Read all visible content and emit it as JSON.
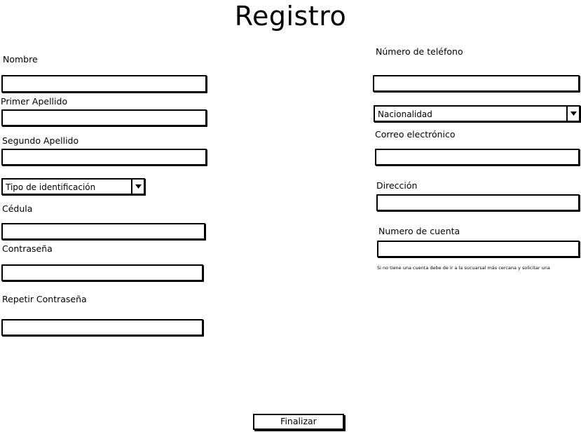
{
  "page": {
    "title": "Registro"
  },
  "left_form": {
    "nombre_label": "Nombre",
    "primer_apellido_label": "Primer Apellido",
    "segundo_apellido_label": "Segundo Apellido",
    "tipo_identificacion_select": "Tipo de identificación",
    "cedula_label": "Cédula",
    "contrasena_label": "Contraseña",
    "repetir_contrasena_label": "Repetir Contraseña"
  },
  "right_form": {
    "telefono_label": "Número de teléfono",
    "nacionalidad_select": "Nacionalidad",
    "correo_label": "Correo electrónico",
    "direccion_label": "Dirección",
    "numero_cuenta_label": "Numero de cuenta",
    "cuenta_note": "Si no tiene una cuenta debe de ir a la sucuarsal más cercana y solicitar una"
  },
  "actions": {
    "finalizar_label": "Finalizar"
  },
  "icons": {
    "select_arrow": "chevron-down-icon"
  }
}
